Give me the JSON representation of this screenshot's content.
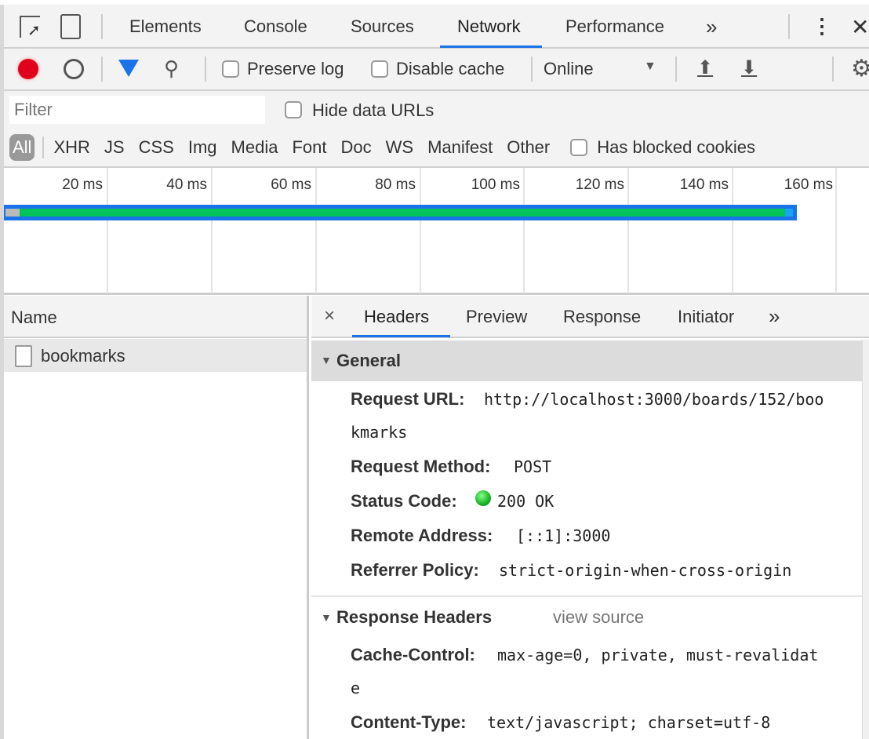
{
  "tabs": [
    "Elements",
    "Console",
    "Sources",
    "Network",
    "Performance"
  ],
  "active_tab": "Network",
  "more": "»",
  "toolbar": {
    "preserve_log": "Preserve log",
    "disable_cache": "Disable cache",
    "throttle": "Online"
  },
  "filter": {
    "placeholder": "Filter",
    "hide_data_urls": "Hide data URLs"
  },
  "types": [
    "All",
    "XHR",
    "JS",
    "CSS",
    "Img",
    "Media",
    "Font",
    "Doc",
    "WS",
    "Manifest",
    "Other"
  ],
  "has_blocked_cookies": "Has blocked cookies",
  "timeline": {
    "ticks": [
      "20 ms",
      "40 ms",
      "60 ms",
      "80 ms",
      "100 ms",
      "120 ms",
      "140 ms",
      "160 ms"
    ]
  },
  "name_header": "Name",
  "requests": [
    {
      "name": "bookmarks"
    }
  ],
  "detail_tabs": [
    "Headers",
    "Preview",
    "Response",
    "Initiator"
  ],
  "general": {
    "title": "General",
    "url_label": "Request URL:",
    "url1": "http://localhost:3000/boards/152/boo",
    "url2": "kmarks",
    "method_label": "Request Method:",
    "method": "POST",
    "status_label": "Status Code:",
    "status": "200 OK",
    "remote_label": "Remote Address:",
    "remote": "[::1]:3000",
    "referrer_label": "Referrer Policy:",
    "referrer": "strict-origin-when-cross-origin"
  },
  "response_headers": {
    "title": "Response Headers",
    "view_source": "view source",
    "cache_label": "Cache-Control:",
    "cache1": "max-age=0, private, must-revalidat",
    "cache2": "e",
    "ctype_label": "Content-Type:",
    "ctype": "text/javascript; charset=utf-8"
  },
  "colors": {
    "accent": "#1a73e8",
    "record": "#e0001b",
    "status_ok": "#19b324",
    "bar_green": "#00c35a"
  }
}
